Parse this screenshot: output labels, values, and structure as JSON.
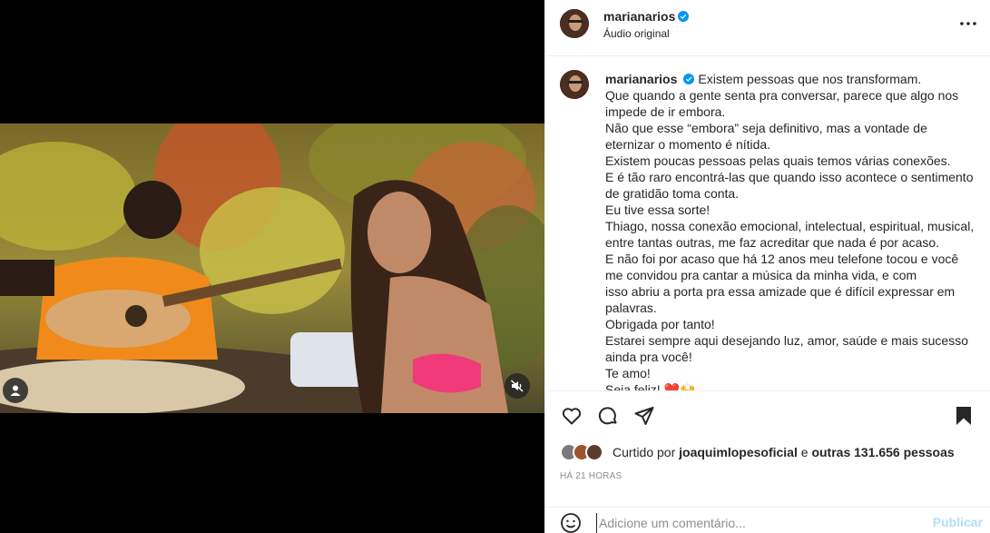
{
  "post": {
    "username": "marianarios",
    "audio_label": "Áudio original"
  },
  "caption": {
    "lines": [
      "Existem pessoas que nos transformam.",
      "Que quando a gente senta pra conversar, parece que algo nos",
      "impede de ir embora.",
      "Não que esse “embora” seja definitivo, mas a vontade de",
      "eternizar o momento é nítida.",
      "Existem poucas pessoas pelas quais temos várias conexões.",
      "E é tão raro encontrá-las que quando isso acontece o sentimento",
      "de gratidão toma conta.",
      "Eu tive essa sorte!",
      "Thiago, nossa conexão emocional, intelectual, espiritual, musical,",
      "entre tantas outras, me faz acreditar que nada é por acaso.",
      "E não foi por acaso que há 12 anos meu telefone tocou e você",
      "me convidou pra cantar a música da minha vida, e com",
      "isso abriu a porta pra essa amizade que é difícil expressar em",
      "palavras.",
      "Obrigada por tanto!",
      "Estarei sempre aqui desejando luz, amor, saúde e mais sucesso",
      "ainda pra você!",
      "Te amo!",
      "Seja feliz! ❤️🙌"
    ]
  },
  "likes": {
    "prefix": "Curtido por",
    "user": "joaquimlopesoficial",
    "connector": "e",
    "others": "outras 131.656 pessoas"
  },
  "timestamp": "HÁ 21 HORAS",
  "comment": {
    "placeholder": "Adicione um comentário...",
    "post_label": "Publicar"
  },
  "icons": {
    "verified": "verified-badge-icon",
    "more": "more-options-icon",
    "like": "heart-icon",
    "comment": "comment-bubble-icon",
    "share": "paper-plane-icon",
    "save": "bookmark-icon",
    "emoji": "smiley-icon",
    "user_tag": "user-tag-icon",
    "mute": "speaker-muted-icon"
  },
  "colors": {
    "verified_blue": "#0095f6",
    "post_button_disabled": "#b2dffc",
    "secondary_text": "#8e8e8e"
  }
}
